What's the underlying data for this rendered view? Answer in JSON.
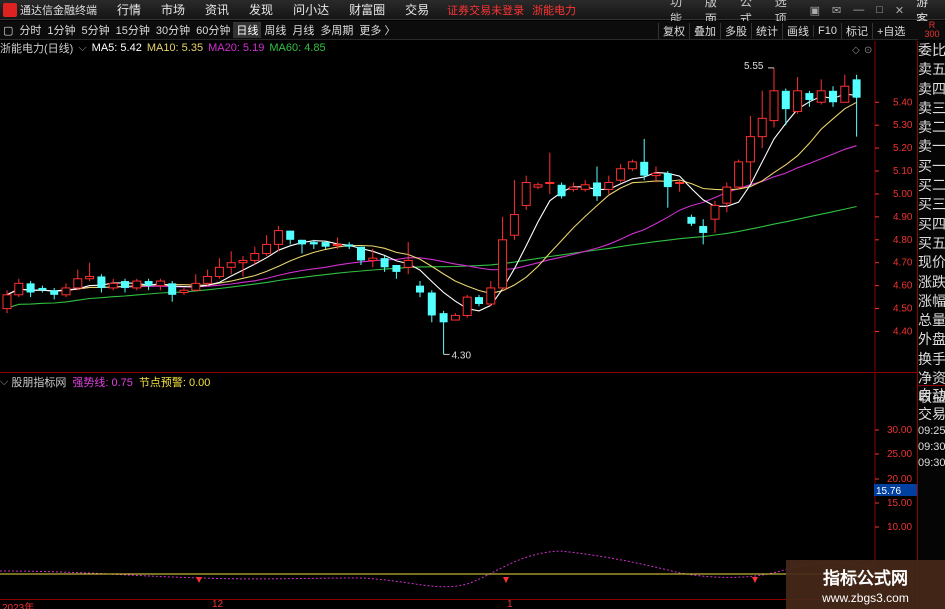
{
  "menu": {
    "app_title": "通达信金融终端",
    "items": [
      "行情",
      "市场",
      "资讯",
      "发现",
      "问小达",
      "财富圈",
      "交易"
    ],
    "login_status": "证券交易未登录",
    "stock_name": "浙能电力",
    "right_items": [
      "功能",
      "版面",
      "公式",
      "选项"
    ],
    "guest": "游客"
  },
  "toolbar": {
    "periods": [
      "分时",
      "1分钟",
      "5分钟",
      "15分钟",
      "30分钟",
      "60分钟",
      "日线",
      "周线",
      "月线",
      "多周期",
      "更多 〉"
    ],
    "active": "日线",
    "right": [
      "复权",
      "叠加",
      "多股",
      "统计",
      "画线",
      "F10",
      "标记",
      "+自选"
    ]
  },
  "chart_header": {
    "title": "浙能电力(日线)",
    "ma5": "MA5: 5.42",
    "ma10": "MA10: 5.35",
    "ma20": "MA20: 5.19",
    "ma60": "MA60: 4.85"
  },
  "chart_data": {
    "type": "candlestick",
    "y_axis": {
      "ticks": [
        5.4,
        5.3,
        5.2,
        5.1,
        5.0,
        4.9,
        4.8,
        4.7,
        4.6,
        4.5,
        4.4
      ]
    },
    "annotations": [
      {
        "text": "5.55",
        "value": 5.55
      },
      {
        "text": "4.30",
        "value": 4.3
      }
    ],
    "candles": [
      [
        4.5,
        4.56,
        4.58,
        4.48
      ],
      [
        4.56,
        4.61,
        4.63,
        4.55
      ],
      [
        4.61,
        4.57,
        4.62,
        4.55
      ],
      [
        4.59,
        4.58,
        4.6,
        4.57
      ],
      [
        4.58,
        4.56,
        4.59,
        4.54
      ],
      [
        4.56,
        4.59,
        4.61,
        4.55
      ],
      [
        4.59,
        4.63,
        4.67,
        4.58
      ],
      [
        4.63,
        4.64,
        4.7,
        4.62
      ],
      [
        4.64,
        4.59,
        4.65,
        4.57
      ],
      [
        4.59,
        4.61,
        4.63,
        4.58
      ],
      [
        4.62,
        4.59,
        4.63,
        4.57
      ],
      [
        4.59,
        4.62,
        4.63,
        4.58
      ],
      [
        4.62,
        4.6,
        4.63,
        4.58
      ],
      [
        4.6,
        4.62,
        4.63,
        4.58
      ],
      [
        4.61,
        4.56,
        4.62,
        4.53
      ],
      [
        4.57,
        4.58,
        4.59,
        4.56
      ],
      [
        4.58,
        4.61,
        4.65,
        4.58
      ],
      [
        4.61,
        4.64,
        4.67,
        4.6
      ],
      [
        4.64,
        4.68,
        4.72,
        4.63
      ],
      [
        4.68,
        4.7,
        4.75,
        4.65
      ],
      [
        4.7,
        4.71,
        4.73,
        4.64
      ],
      [
        4.71,
        4.74,
        4.77,
        4.69
      ],
      [
        4.74,
        4.78,
        4.82,
        4.73
      ],
      [
        4.78,
        4.84,
        4.86,
        4.75
      ],
      [
        4.84,
        4.8,
        4.84,
        4.78
      ],
      [
        4.8,
        4.78,
        4.8,
        4.74
      ],
      [
        4.79,
        4.78,
        4.8,
        4.76
      ],
      [
        4.79,
        4.77,
        4.79,
        4.76
      ],
      [
        4.78,
        4.78,
        4.81,
        4.76
      ],
      [
        4.78,
        4.77,
        4.79,
        4.76
      ],
      [
        4.77,
        4.71,
        4.77,
        4.69
      ],
      [
        4.71,
        4.72,
        4.76,
        4.68
      ],
      [
        4.72,
        4.68,
        4.73,
        4.66
      ],
      [
        4.69,
        4.66,
        4.69,
        4.63
      ],
      [
        4.68,
        4.71,
        4.79,
        4.65
      ],
      [
        4.6,
        4.57,
        4.62,
        4.55
      ],
      [
        4.57,
        4.47,
        4.58,
        4.44
      ],
      [
        4.48,
        4.44,
        4.49,
        4.3
      ],
      [
        4.45,
        4.47,
        4.48,
        4.45
      ],
      [
        4.47,
        4.55,
        4.56,
        4.46
      ],
      [
        4.55,
        4.52,
        4.56,
        4.51
      ],
      [
        4.52,
        4.59,
        4.62,
        4.51
      ],
      [
        4.59,
        4.8,
        4.9,
        4.58
      ],
      [
        4.82,
        4.91,
        5.06,
        4.8
      ],
      [
        4.95,
        5.05,
        5.08,
        4.93
      ],
      [
        5.03,
        5.04,
        5.05,
        5.02
      ],
      [
        5.05,
        5.05,
        5.18,
        5.0
      ],
      [
        5.04,
        4.99,
        5.05,
        4.98
      ],
      [
        5.02,
        5.03,
        5.05,
        5.01
      ],
      [
        5.02,
        5.04,
        5.06,
        5.01
      ],
      [
        5.05,
        4.99,
        5.12,
        4.97
      ],
      [
        5.02,
        5.05,
        5.08,
        5.0
      ],
      [
        5.06,
        5.11,
        5.13,
        5.05
      ],
      [
        5.11,
        5.14,
        5.15,
        5.1
      ],
      [
        5.14,
        5.08,
        5.24,
        5.06
      ],
      [
        5.08,
        5.09,
        5.12,
        5.05
      ],
      [
        5.09,
        5.03,
        5.1,
        4.94
      ],
      [
        5.05,
        5.05,
        5.06,
        5.01
      ],
      [
        4.9,
        4.87,
        4.91,
        4.86
      ],
      [
        4.86,
        4.83,
        4.89,
        4.78
      ],
      [
        4.89,
        4.95,
        4.97,
        4.83
      ],
      [
        4.96,
        5.03,
        5.05,
        4.92
      ],
      [
        5.03,
        5.14,
        5.15,
        5.02
      ],
      [
        5.14,
        5.25,
        5.34,
        5.05
      ],
      [
        5.25,
        5.33,
        5.45,
        5.2
      ],
      [
        5.32,
        5.45,
        5.55,
        5.29
      ],
      [
        5.45,
        5.37,
        5.46,
        5.3
      ],
      [
        5.36,
        5.45,
        5.51,
        5.35
      ],
      [
        5.44,
        5.41,
        5.45,
        5.38
      ],
      [
        5.4,
        5.45,
        5.5,
        5.39
      ],
      [
        5.45,
        5.4,
        5.47,
        5.38
      ],
      [
        5.4,
        5.47,
        5.52,
        5.4
      ],
      [
        5.5,
        5.42,
        5.52,
        5.25
      ]
    ],
    "ma_colors": {
      "ma5": "#ffffff",
      "ma10": "#e8d36a",
      "ma20": "#d030d0",
      "ma60": "#30c040"
    },
    "up_color": "#ff3030",
    "down_color": "#54ffff"
  },
  "right_panel": {
    "items": [
      "委比",
      "卖五",
      "卖四",
      "卖三",
      "卖二",
      "卖一",
      "买一",
      "买二",
      "买三",
      "买四",
      "买五",
      "现价",
      "涨跌",
      "涨幅",
      "总量",
      "外盘",
      "换手",
      "净资",
      "收益"
    ],
    "auto_label": "自动",
    "trade_label": "交易",
    "times": [
      "09:25",
      "09:30",
      "09:30"
    ],
    "corner": "R",
    "corner_num": "300"
  },
  "indicator": {
    "name": "股朋指标网",
    "trend_label": "强势线: 0.75",
    "warn_label": "节点预警: 0.00",
    "ticks": [
      "30.00",
      "25.00",
      "20.00",
      "15.00",
      "10.00"
    ],
    "current": "15.76"
  },
  "bottom_axis": {
    "labels": [
      "2023年",
      "12",
      "1"
    ]
  },
  "watermark": {
    "line1": "指标公式网",
    "line2": "www.zbgs3.com"
  }
}
